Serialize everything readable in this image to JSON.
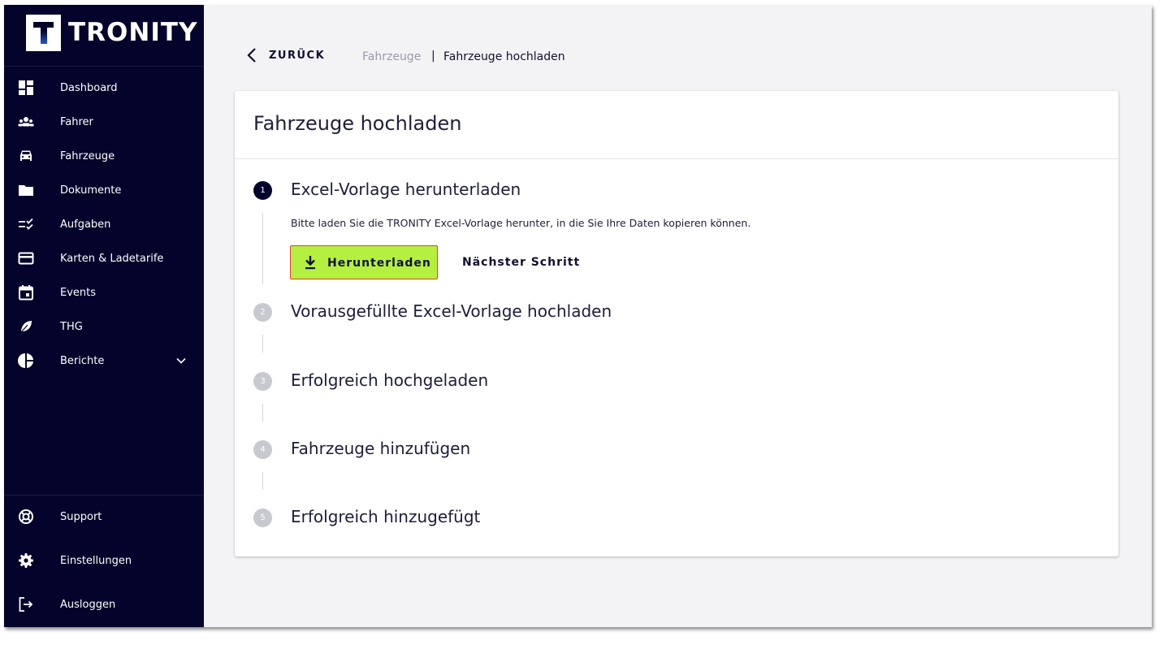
{
  "brand": {
    "name": "TRONITY",
    "logo_letter": "T"
  },
  "sidebar": {
    "items": [
      {
        "label": "Dashboard",
        "icon": "dashboard-icon"
      },
      {
        "label": "Fahrer",
        "icon": "people-icon"
      },
      {
        "label": "Fahrzeuge",
        "icon": "car-icon"
      },
      {
        "label": "Dokumente",
        "icon": "folder-icon"
      },
      {
        "label": "Aufgaben",
        "icon": "checklist-icon"
      },
      {
        "label": "Karten & Ladetarife",
        "icon": "card-icon"
      },
      {
        "label": "Events",
        "icon": "calendar-icon"
      },
      {
        "label": "THG",
        "icon": "leaf-icon"
      },
      {
        "label": "Berichte",
        "icon": "pie-chart-icon",
        "expandable": true
      }
    ],
    "bottom_items": [
      {
        "label": "Support",
        "icon": "lifebuoy-icon"
      },
      {
        "label": "Einstellungen",
        "icon": "gear-icon"
      },
      {
        "label": "Ausloggen",
        "icon": "logout-icon"
      }
    ]
  },
  "header": {
    "back_label": "ZURÜCK",
    "breadcrumb": [
      "Fahrzeuge",
      "Fahrzeuge hochladen"
    ],
    "separator": "|"
  },
  "card": {
    "title": "Fahrzeuge hochladen",
    "steps": [
      {
        "number": "1",
        "title": "Excel-Vorlage herunterladen",
        "active": true,
        "description": "Bitte laden Sie die TRONITY Excel-Vorlage herunter, in die Sie Ihre Daten kopieren können."
      },
      {
        "number": "2",
        "title": "Vorausgefüllte Excel-Vorlage hochladen",
        "active": false
      },
      {
        "number": "3",
        "title": "Erfolgreich hochgeladen",
        "active": false
      },
      {
        "number": "4",
        "title": "Fahrzeuge hinzufügen",
        "active": false
      },
      {
        "number": "5",
        "title": "Erfolgreich hinzugefügt",
        "active": false
      }
    ],
    "download_label": "Herunterladen",
    "next_label": "Nächster Schritt"
  },
  "colors": {
    "sidebar_bg": "#03032b",
    "accent_green": "#b4f040",
    "highlight_border": "#e53b3b",
    "step_active": "#03032b",
    "step_inactive": "#c8c8d0"
  }
}
